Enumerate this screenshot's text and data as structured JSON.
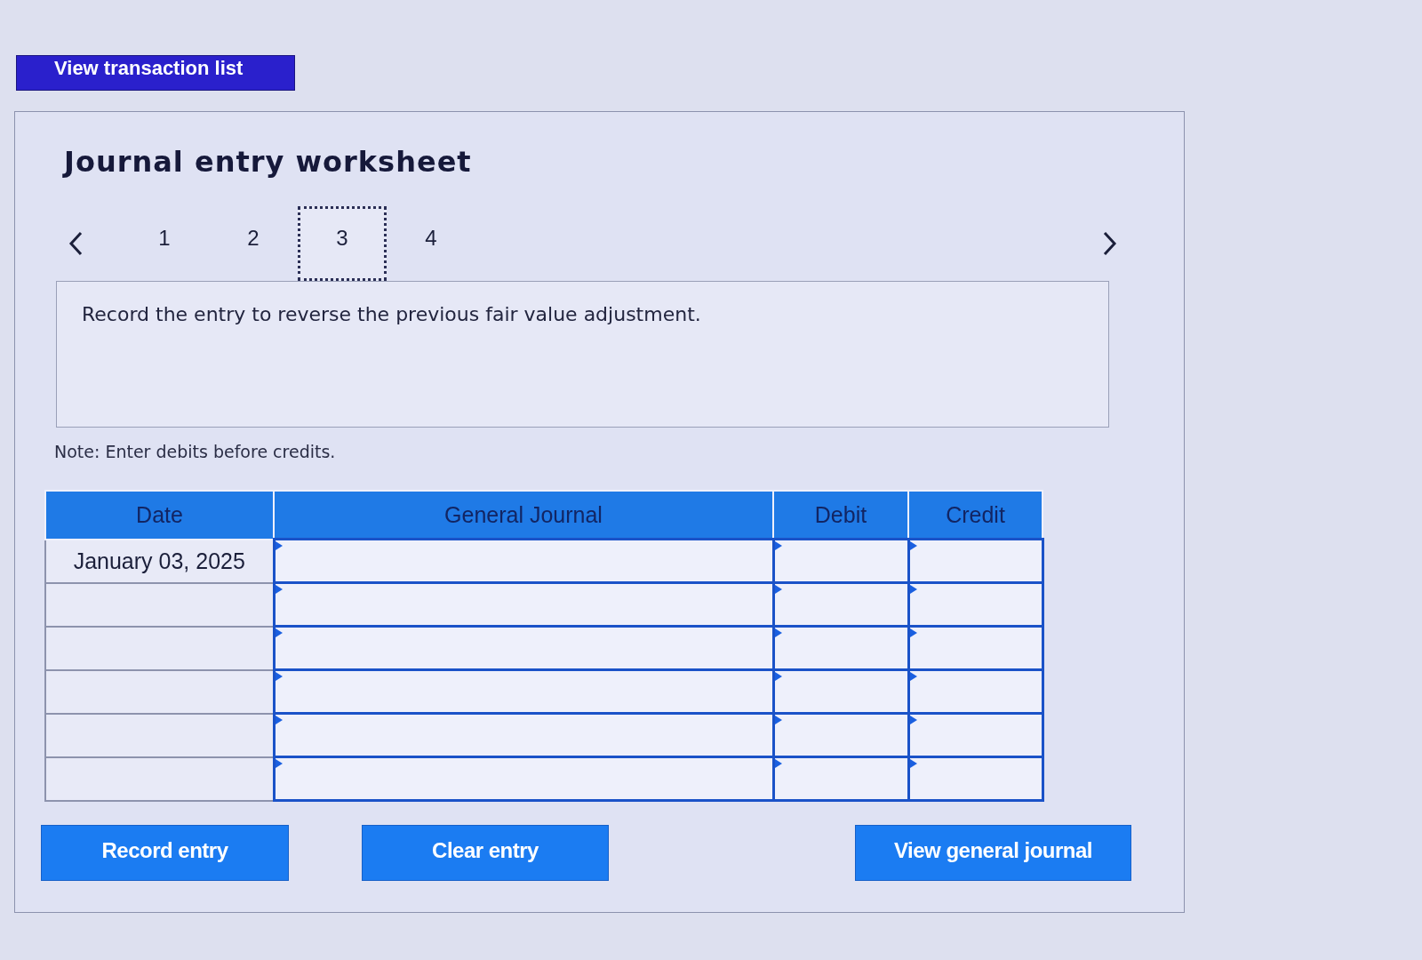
{
  "top_button": {
    "label": "View transaction list"
  },
  "worksheet": {
    "title": "Journal entry worksheet",
    "tabs": [
      {
        "label": "1",
        "selected": false
      },
      {
        "label": "2",
        "selected": false
      },
      {
        "label": "3",
        "selected": true
      },
      {
        "label": "4",
        "selected": false
      }
    ],
    "instruction": "Record the entry to reverse the previous fair value adjustment.",
    "note": "Note: Enter debits before credits.",
    "table": {
      "columns": [
        "Date",
        "General Journal",
        "Debit",
        "Credit"
      ],
      "rows": [
        {
          "date": "January 03, 2025"
        },
        {},
        {},
        {},
        {},
        {}
      ]
    },
    "buttons": [
      {
        "label": "Record entry"
      },
      {
        "label": "Clear entry"
      },
      {
        "label": "View general journal"
      }
    ]
  }
}
